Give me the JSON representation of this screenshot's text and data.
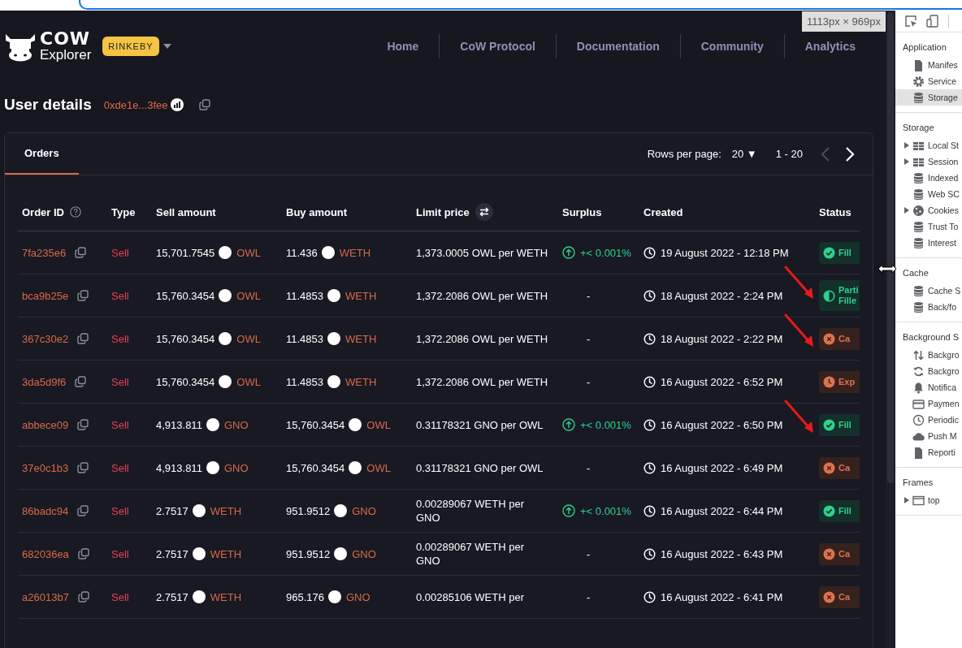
{
  "browser": {
    "viewport_size": "1113px × 969px"
  },
  "header": {
    "logo": {
      "wordmark": "COW",
      "subtitle": "Explorer"
    },
    "network": "RINKEBY",
    "nav": [
      "Home",
      "CoW Protocol",
      "Documentation",
      "Community",
      "Analytics"
    ]
  },
  "user": {
    "title": "User details",
    "address": "0xde1e...3fee"
  },
  "tabs": [
    {
      "label": "Orders",
      "selected": true
    }
  ],
  "pagination": {
    "rows_label": "Rows per page:",
    "rows_value": "20",
    "rows_caret": "▼",
    "range": "1 - 20",
    "prev_disabled": true,
    "next_disabled": false
  },
  "table": {
    "columns": [
      {
        "label": "Order ID",
        "kind": "help"
      },
      {
        "label": "Type",
        "kind": "plain"
      },
      {
        "label": "Sell amount",
        "kind": "plain"
      },
      {
        "label": "Buy amount",
        "kind": "plain"
      },
      {
        "label": "Limit price",
        "kind": "swap"
      },
      {
        "label": "Surplus",
        "kind": "plain"
      },
      {
        "label": "Created",
        "kind": "plain"
      },
      {
        "label": "Status",
        "kind": "plain"
      }
    ],
    "rows": [
      {
        "id": "7fa235e6",
        "type": "Sell",
        "sell": {
          "amount": "15,701.7545",
          "token": "OWL"
        },
        "buy": {
          "amount": "11.436",
          "token": "WETH"
        },
        "limit_price": "1,373.0005 OWL per WETH",
        "surplus": {
          "text": "+< 0.001%",
          "positive": true
        },
        "created": "19 August 2022 - 12:18 PM",
        "status": {
          "kind": "filled",
          "label": "Fill"
        },
        "arrow": false
      },
      {
        "id": "bca9b25e",
        "type": "Sell",
        "sell": {
          "amount": "15,760.3454",
          "token": "OWL"
        },
        "buy": {
          "amount": "11.4853",
          "token": "WETH"
        },
        "limit_price": "1,372.2086 OWL per WETH",
        "surplus": {
          "text": "-",
          "positive": false
        },
        "created": "18 August 2022 - 2:24 PM",
        "status": {
          "kind": "partial",
          "label": "Parti Fille"
        },
        "arrow": true
      },
      {
        "id": "367c30e2",
        "type": "Sell",
        "sell": {
          "amount": "15,760.3454",
          "token": "OWL"
        },
        "buy": {
          "amount": "11.4853",
          "token": "WETH"
        },
        "limit_price": "1,372.2086 OWL per WETH",
        "surplus": {
          "text": "-",
          "positive": false
        },
        "created": "18 August 2022 - 2:22 PM",
        "status": {
          "kind": "cancelled",
          "label": "Ca"
        },
        "arrow": true
      },
      {
        "id": "3da5d9f6",
        "type": "Sell",
        "sell": {
          "amount": "15,760.3454",
          "token": "OWL"
        },
        "buy": {
          "amount": "11.4853",
          "token": "WETH"
        },
        "limit_price": "1,372.2086 OWL per WETH",
        "surplus": {
          "text": "-",
          "positive": false
        },
        "created": "16 August 2022 - 6:52 PM",
        "status": {
          "kind": "expired",
          "label": "Exp"
        },
        "arrow": false
      },
      {
        "id": "abbece09",
        "type": "Sell",
        "sell": {
          "amount": "4,913.811",
          "token": "GNO"
        },
        "buy": {
          "amount": "15,760.3454",
          "token": "OWL"
        },
        "limit_price": "0.31178321 GNO per OWL",
        "surplus": {
          "text": "+< 0.001%",
          "positive": true
        },
        "created": "16 August 2022 - 6:50 PM",
        "status": {
          "kind": "filled",
          "label": "Fill"
        },
        "arrow": true
      },
      {
        "id": "37e0c1b3",
        "type": "Sell",
        "sell": {
          "amount": "4,913.811",
          "token": "GNO"
        },
        "buy": {
          "amount": "15,760.3454",
          "token": "OWL"
        },
        "limit_price": "0.31178321 GNO per OWL",
        "surplus": {
          "text": "-",
          "positive": false
        },
        "created": "16 August 2022 - 6:49 PM",
        "status": {
          "kind": "cancelled",
          "label": "Ca"
        },
        "arrow": false
      },
      {
        "id": "86badc94",
        "type": "Sell",
        "sell": {
          "amount": "2.7517",
          "token": "WETH"
        },
        "buy": {
          "amount": "951.9512",
          "token": "GNO"
        },
        "limit_price": "0.00289067 WETH per GNO",
        "surplus": {
          "text": "+< 0.001%",
          "positive": true
        },
        "created": "16 August 2022 - 6:44 PM",
        "status": {
          "kind": "filled",
          "label": "Fill"
        },
        "arrow": false
      },
      {
        "id": "682036ea",
        "type": "Sell",
        "sell": {
          "amount": "2.7517",
          "token": "WETH"
        },
        "buy": {
          "amount": "951.9512",
          "token": "GNO"
        },
        "limit_price": "0.00289067 WETH per GNO",
        "surplus": {
          "text": "-",
          "positive": false
        },
        "created": "16 August 2022 - 6:43 PM",
        "status": {
          "kind": "cancelled",
          "label": "Ca"
        },
        "arrow": false
      },
      {
        "id": "a26013b7",
        "type": "Sell",
        "sell": {
          "amount": "2.7517",
          "token": "WETH"
        },
        "buy": {
          "amount": "965.176",
          "token": "GNO"
        },
        "limit_price": "0.00285106 WETH per",
        "surplus": {
          "text": "-",
          "positive": false
        },
        "created": "16 August 2022 - 6:41 PM",
        "status": {
          "kind": "cancelled",
          "label": "Ca"
        },
        "arrow": false
      }
    ]
  },
  "devtools": {
    "sections": [
      {
        "title": "Application",
        "items": [
          {
            "label": "Manifes",
            "kind": "file",
            "expandable": false,
            "selected": false
          },
          {
            "label": "Service",
            "kind": "gear",
            "expandable": false,
            "selected": false
          },
          {
            "label": "Storage",
            "kind": "database",
            "expandable": false,
            "selected": true
          }
        ]
      },
      {
        "title": "Storage",
        "items": [
          {
            "label": "Local St",
            "kind": "grid",
            "expandable": true,
            "selected": false
          },
          {
            "label": "Session",
            "kind": "grid",
            "expandable": true,
            "selected": false
          },
          {
            "label": "Indexed",
            "kind": "database",
            "expandable": false,
            "selected": false
          },
          {
            "label": "Web SC",
            "kind": "database",
            "expandable": false,
            "selected": false
          },
          {
            "label": "Cookies",
            "kind": "cookie",
            "expandable": true,
            "selected": false
          },
          {
            "label": "Trust To",
            "kind": "database",
            "expandable": false,
            "selected": false
          },
          {
            "label": "Interest",
            "kind": "database",
            "expandable": false,
            "selected": false
          }
        ]
      },
      {
        "title": "Cache",
        "items": [
          {
            "label": "Cache S",
            "kind": "database",
            "expandable": false,
            "selected": false
          },
          {
            "label": "Back/fo",
            "kind": "database",
            "expandable": false,
            "selected": false
          }
        ]
      },
      {
        "title": "Background S",
        "items": [
          {
            "label": "Backgro",
            "kind": "updown",
            "expandable": false,
            "selected": false
          },
          {
            "label": "Backgro",
            "kind": "sync",
            "expandable": false,
            "selected": false
          },
          {
            "label": "Notifica",
            "kind": "bell",
            "expandable": false,
            "selected": false
          },
          {
            "label": "Paymen",
            "kind": "card",
            "expandable": false,
            "selected": false
          },
          {
            "label": "Periodic",
            "kind": "clock",
            "expandable": false,
            "selected": false
          },
          {
            "label": "Push M",
            "kind": "cloud",
            "expandable": false,
            "selected": false
          },
          {
            "label": "Reporti",
            "kind": "file",
            "expandable": false,
            "selected": false
          }
        ]
      },
      {
        "title": "Frames",
        "items": [
          {
            "label": "top",
            "kind": "frame",
            "expandable": true,
            "selected": false
          }
        ]
      }
    ]
  }
}
